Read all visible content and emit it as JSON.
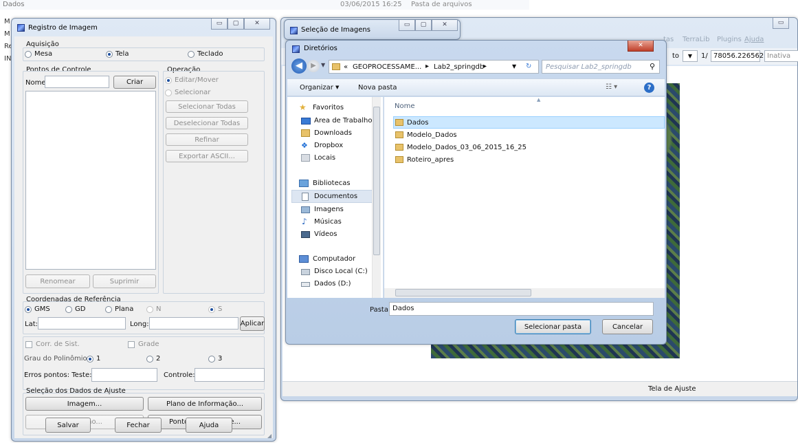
{
  "background": {
    "top_row_name": "Dados",
    "top_row_date": "03/06/2015 16:25",
    "top_row_type": "Pasta de arquivos",
    "left_letters": [
      "M",
      "M",
      "Re",
      "IN"
    ]
  },
  "registro": {
    "title": "Registro de Imagem",
    "aquisicao_label": "Aquisição",
    "aquisicao_options": [
      "Mesa",
      "Tela",
      "Teclado"
    ],
    "aquisicao_selected": "Tela",
    "pontos_label": "Pontos de Controle",
    "nome_label": "Nome:",
    "criar_button": "Criar",
    "operacao_label": "Operação",
    "operacao_options": [
      "Editar/Mover",
      "Selecionar"
    ],
    "op_buttons": [
      "Selecionar Todas",
      "Deselecionar Todas",
      "Refinar",
      "Exportar ASCII..."
    ],
    "renomear_button": "Renomear",
    "suprimir_button": "Suprimir",
    "coord_label": "Coordenadas de Referência",
    "coord_options": [
      "GMS",
      "GD",
      "Plana",
      "N",
      "S"
    ],
    "coord_selected": "GMS",
    "lat_label": "Lat:",
    "long_label": "Long:",
    "aplicar_button": "Aplicar",
    "corr_label": "Corr. de Sist.",
    "grade_label": "Grade",
    "grau_label": "Grau do Polinômio:",
    "grau_options": [
      "1",
      "2",
      "3"
    ],
    "grau_selected": "1",
    "erros_label": "Erros pontos: Teste:",
    "controle_label": "Controle:",
    "selecao_label": "Seleção dos Dados de Ajuste",
    "imagem_button": "Imagem...",
    "plano_button": "Plano de Informação...",
    "projecao_button": "Projeção...",
    "pontos_button": "Pontos de Controle...",
    "salvar_button": "Salvar",
    "fechar_button": "Fechar",
    "ajuda_button": "Ajuda"
  },
  "selecao_imagens": {
    "title": "Seleção de Imagens"
  },
  "main_window": {
    "menu_items": [
      "tas",
      "TerraLib",
      "Plugins",
      "Ajuda"
    ],
    "toolbar_text_to": "to",
    "scale_prefix": "1/",
    "scale_value": "78056.226562",
    "status_combo": "Inativa",
    "status_bar": "Tela de Ajuste"
  },
  "diretorios": {
    "title": "Diretórios",
    "breadcrumb": [
      "«",
      "GEOPROCESSAME...",
      "Lab2_springdb"
    ],
    "search_placeholder": "Pesquisar Lab2_springdb",
    "organizar_label": "Organizar",
    "nova_pasta_label": "Nova pasta",
    "nav": {
      "favoritos_header": "Favoritos",
      "favoritos": [
        "Área de Trabalho",
        "Downloads",
        "Dropbox",
        "Locais"
      ],
      "bibliotecas_header": "Bibliotecas",
      "bibliotecas": [
        "Documentos",
        "Imagens",
        "Músicas",
        "Vídeos"
      ],
      "computador_header": "Computador",
      "computador": [
        "Disco Local (C:)",
        "Dados (D:)"
      ]
    },
    "column_header": "Nome",
    "files": [
      "Dados",
      "Modelo_Dados",
      "Modelo_Dados_03_06_2015_16_25",
      "Roteiro_apres"
    ],
    "selected_file": "Dados",
    "pasta_label": "Pasta:",
    "pasta_value": "Dados",
    "select_button": "Selecionar pasta",
    "cancel_button": "Cancelar"
  },
  "colors": {
    "selection": "#cce8ff",
    "nav_selected": "#dde6f2",
    "folder": "#e8c26a",
    "accent": "#3a7bd5"
  }
}
